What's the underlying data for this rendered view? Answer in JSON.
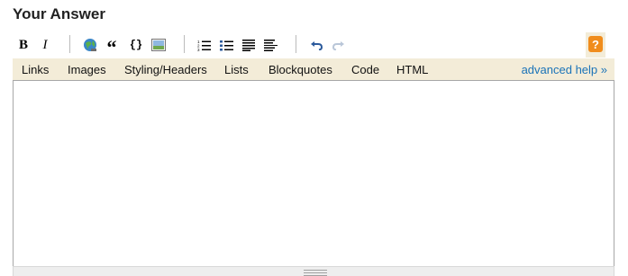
{
  "heading": "Your Answer",
  "toolbar": {
    "bold_label": "B",
    "italic_label": "I",
    "blockquote_label": "“",
    "code_label": "{}",
    "help_label": "?"
  },
  "help_tabs": [
    "Links",
    "Images",
    "Styling/Headers",
    "Lists",
    "Blockquotes",
    "Code",
    "HTML"
  ],
  "advanced_help": "advanced help »",
  "editor": {
    "value": ""
  },
  "colors": {
    "help_bar_bg": "#f3ecd8",
    "link": "#1a73b8",
    "help_button": "#f08c1c"
  }
}
